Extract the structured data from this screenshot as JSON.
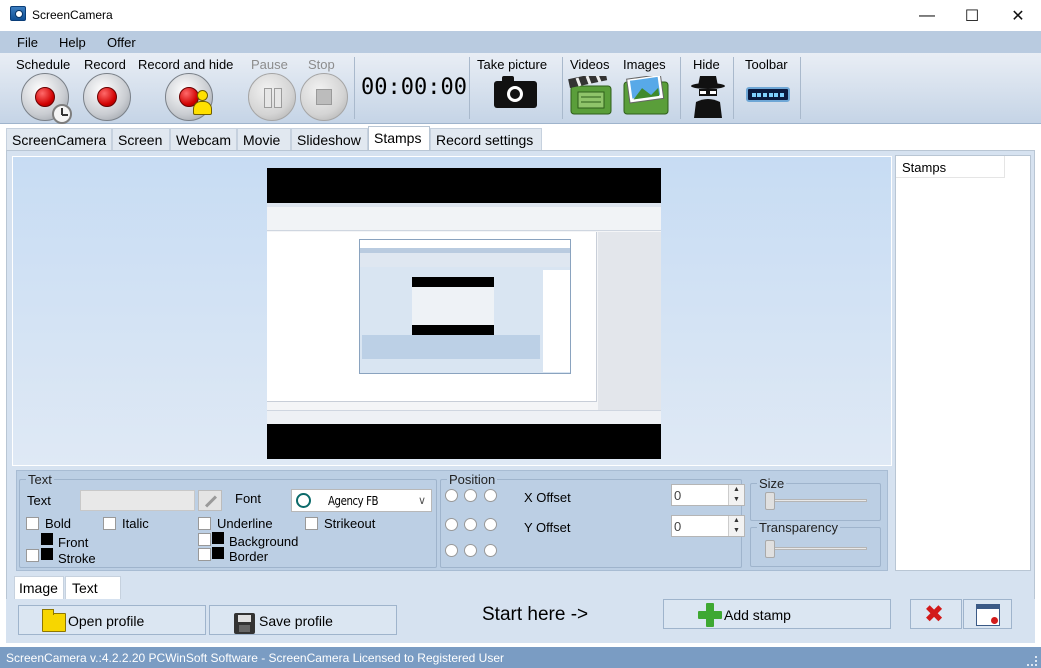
{
  "window": {
    "title": "ScreenCamera",
    "minimize": "—",
    "maximize": "☐",
    "close": "✕"
  },
  "menu": [
    "File",
    "Help",
    "Offer"
  ],
  "toolbar": {
    "schedule": "Schedule",
    "record": "Record",
    "record_and_hide": "Record and hide",
    "pause": "Pause",
    "stop": "Stop",
    "timer": "00:00:00",
    "take_picture": "Take picture",
    "videos": "Videos",
    "images": "Images",
    "hide": "Hide",
    "toolbar": "Toolbar"
  },
  "tabs": [
    "ScreenCamera",
    "Screen",
    "Webcam",
    "Movie",
    "Slideshow",
    "Stamps",
    "Record settings"
  ],
  "active_tab": "Stamps",
  "text_group": {
    "legend": "Text",
    "text_label": "Text",
    "text_value": "",
    "font_label": "Font",
    "font_value": "Agency FB",
    "bold": "Bold",
    "italic": "Italic",
    "underline": "Underline",
    "strikeout": "Strikeout",
    "front": "Front",
    "stroke": "Stroke",
    "background": "Background",
    "border": "Border"
  },
  "position_group": {
    "legend": "Position",
    "x_offset_label": "X Offset",
    "x_offset_value": "0",
    "y_offset_label": "Y Offset",
    "y_offset_value": "0"
  },
  "size_group": {
    "legend": "Size"
  },
  "transparency_group": {
    "legend": "Transparency"
  },
  "stamps_list": {
    "header": "Stamps"
  },
  "subtabs": [
    "Image",
    "Text"
  ],
  "buttons": {
    "open_profile": "Open profile",
    "save_profile": "Save profile",
    "start_here": "Start here ->",
    "add_stamp": "Add stamp"
  },
  "status": "ScreenCamera v.:4.2.2.20 PCWinSoft Software - ScreenCamera Licensed to Registered User",
  "colors": {
    "menubar": "#b9cbe0",
    "statusbar": "#7a9cc3",
    "record_red": "#d00000"
  }
}
